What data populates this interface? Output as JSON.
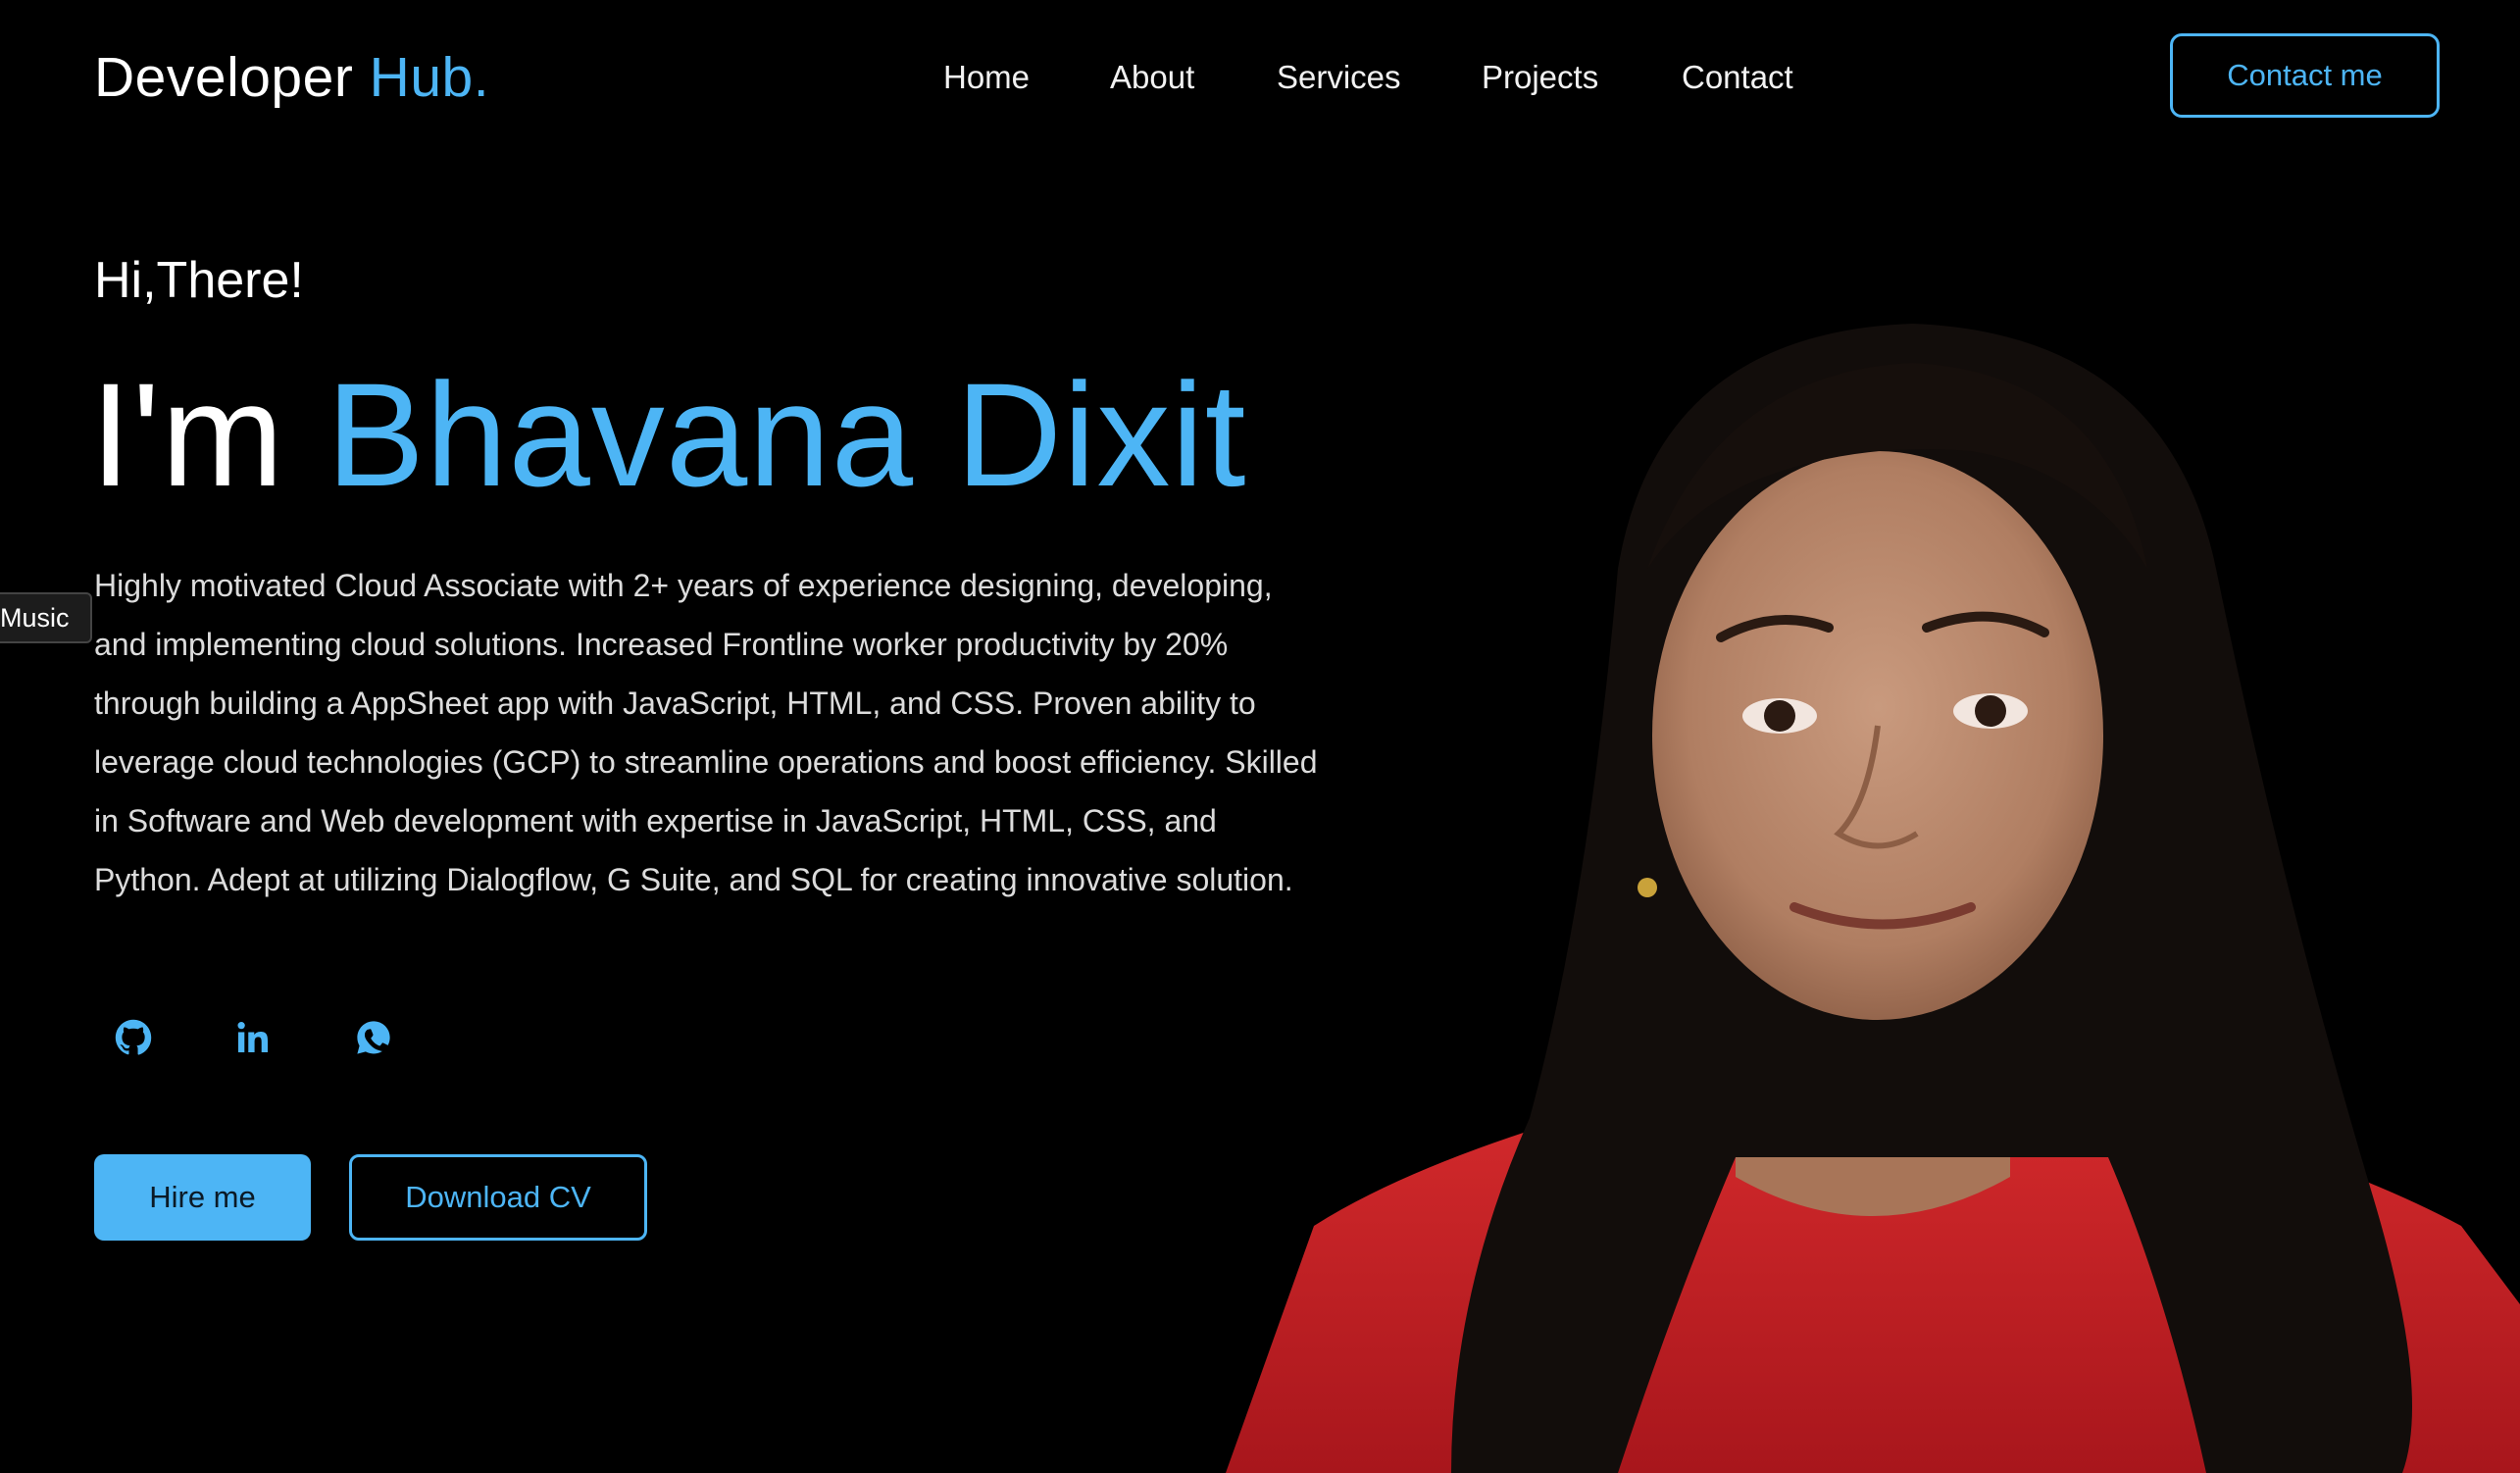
{
  "header": {
    "logo_main": "Developer",
    "logo_accent": "Hub.",
    "nav": {
      "home": "Home",
      "about": "About",
      "services": "Services",
      "projects": "Projects",
      "contact": "Contact"
    },
    "contact_button": "Contact me"
  },
  "hero": {
    "greeting": "Hi,There!",
    "name_prefix": "I'm",
    "name": "Bhavana Dixit",
    "bio": "Highly motivated Cloud Associate with 2+ years of experience designing, developing, and implementing cloud solutions. Increased Frontline worker productivity by 20% through building a AppSheet app with JavaScript, HTML, and CSS. Proven ability to leverage cloud technologies (GCP) to streamline operations and boost efficiency. Skilled in Software and Web development with expertise in JavaScript, HTML, CSS, and Python. Adept at utilizing Dialogflow, G Suite, and SQL for creating innovative solution.",
    "socials": [
      "github-icon",
      "linkedin-icon",
      "whatsapp-icon"
    ],
    "hire_button": "Hire me",
    "cv_button": "Download CV"
  },
  "music_tab": "Music",
  "colors": {
    "accent": "#4db5f5",
    "background": "#000000",
    "text": "#ffffff",
    "shirt": "#c81e24"
  }
}
